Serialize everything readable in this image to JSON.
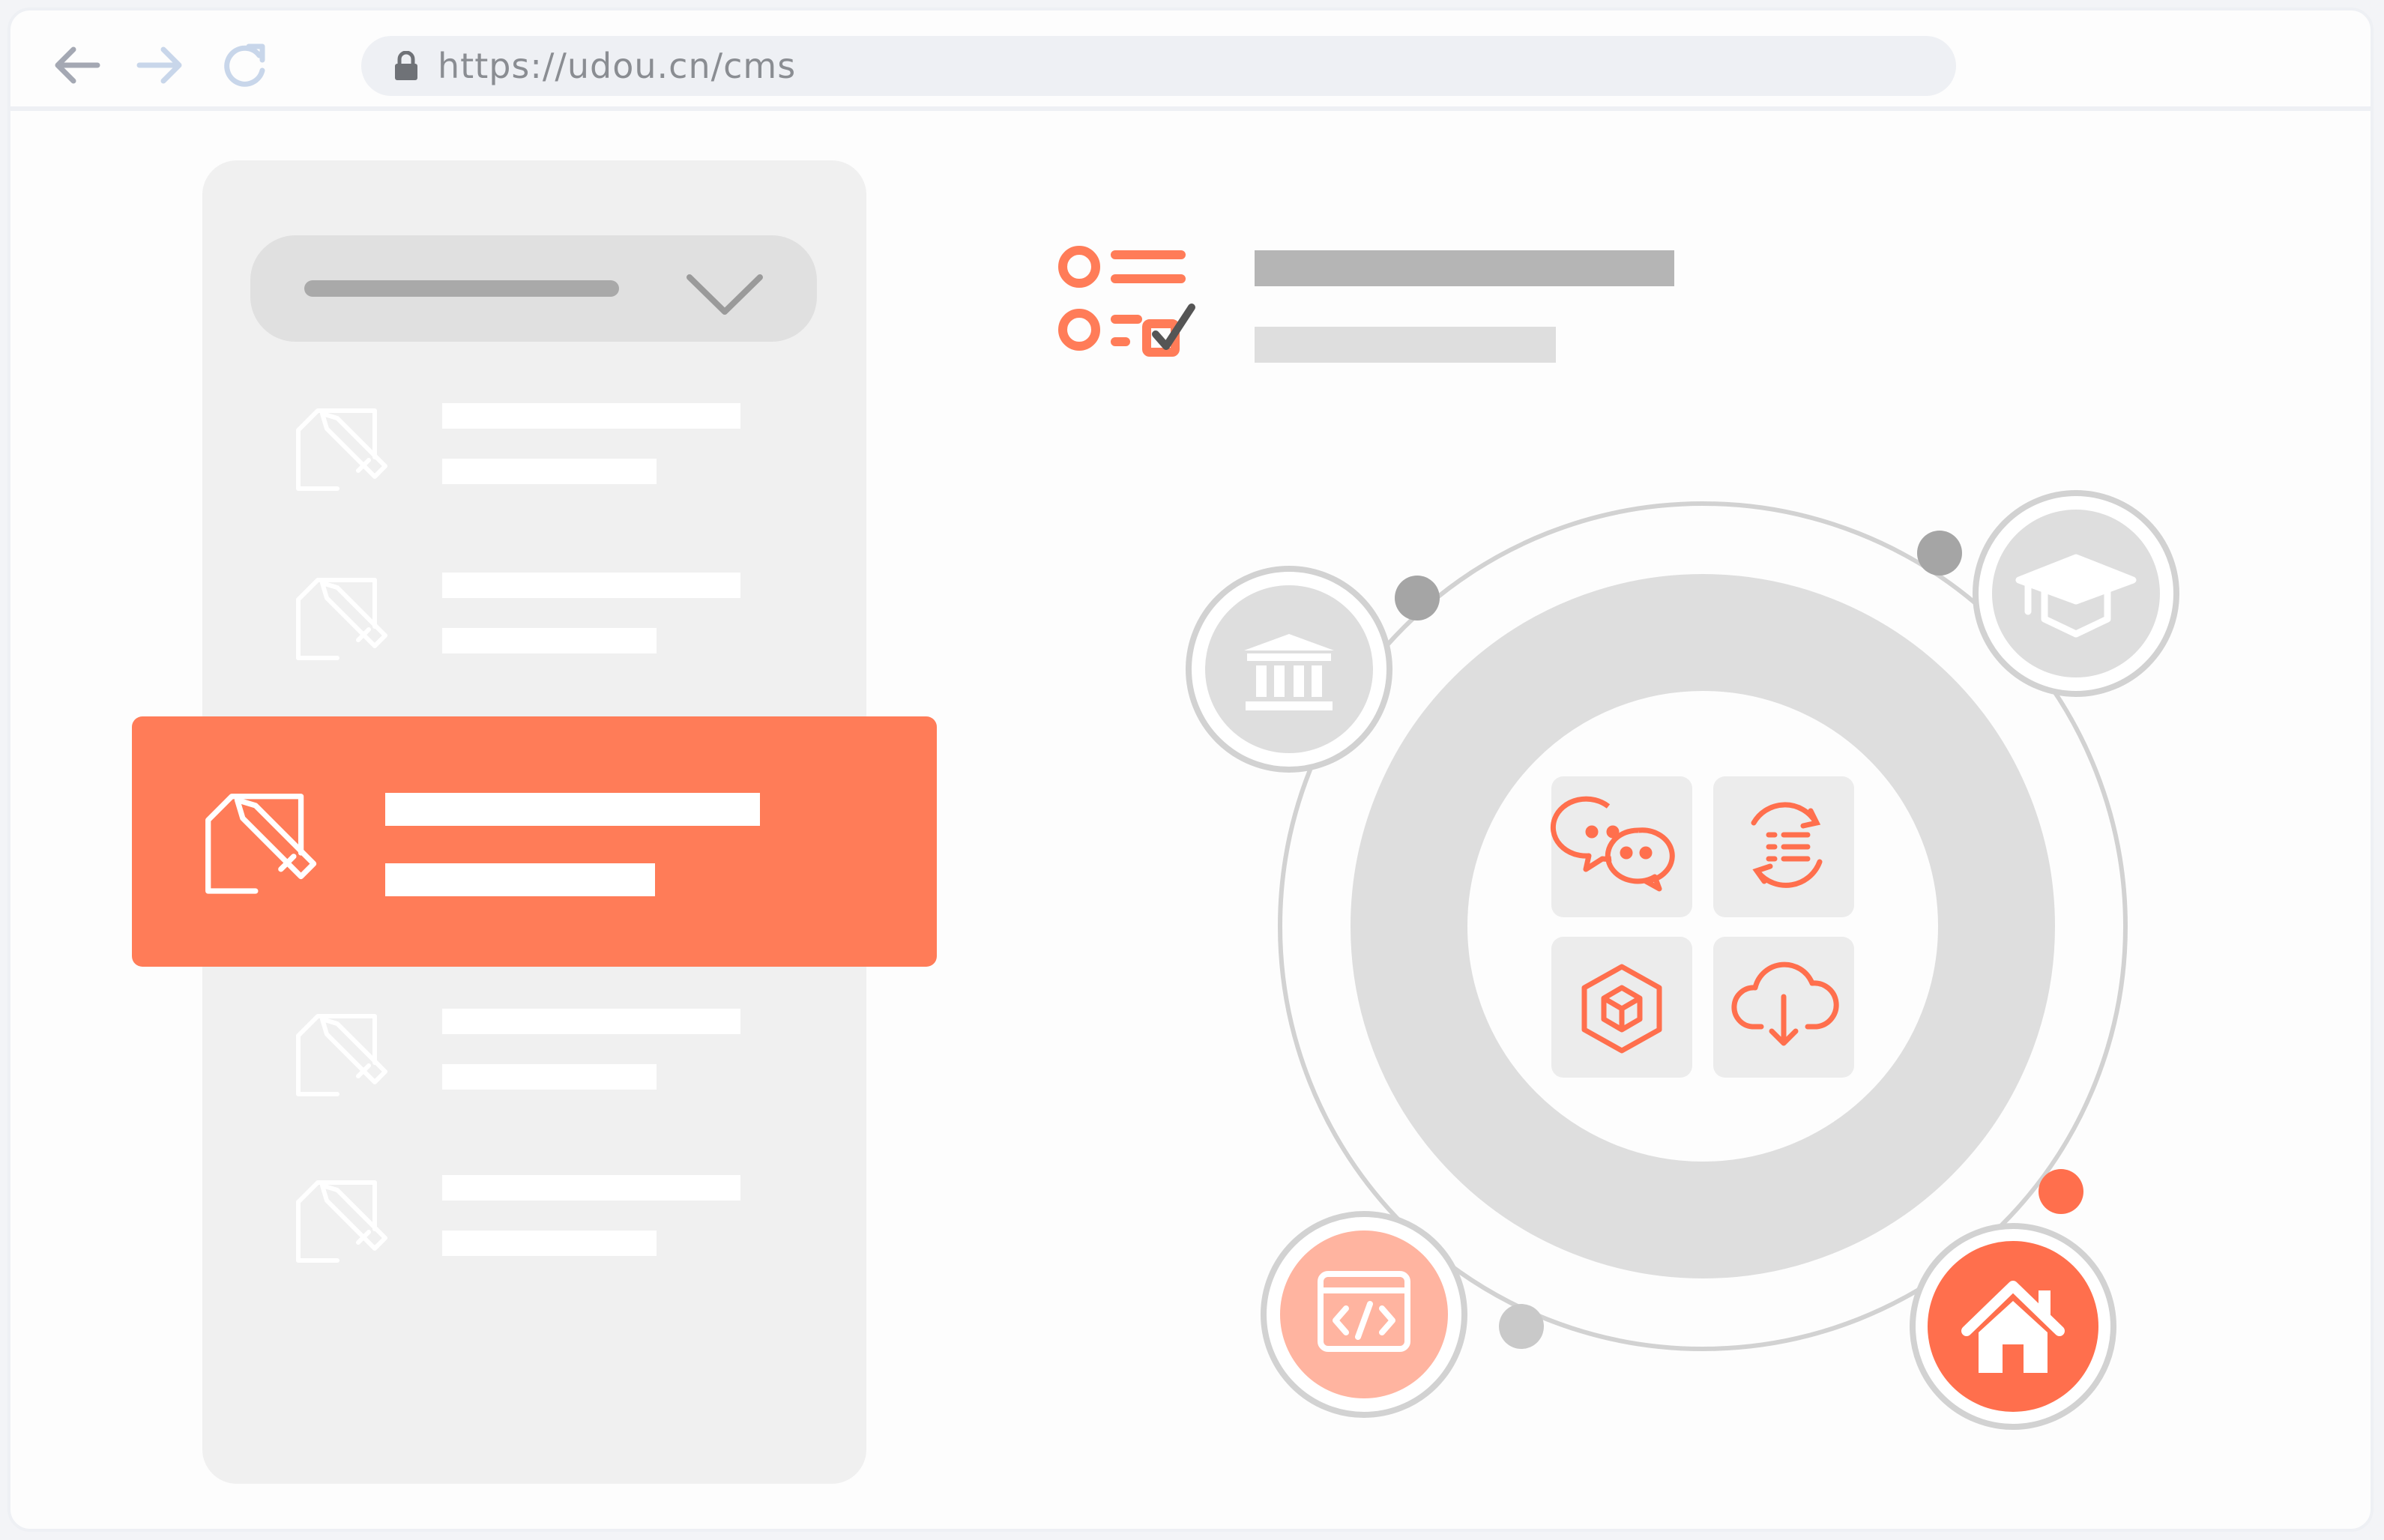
{
  "browser": {
    "url": "https://udou.cn/cms",
    "nav": {
      "back_icon": "arrow-left-icon",
      "forward_icon": "arrow-right-icon",
      "reload_icon": "reload-icon",
      "lock_icon": "lock-icon"
    }
  },
  "sidebar": {
    "dropdown_icon": "chevron-down-icon",
    "items": [
      {
        "icon": "edit-document-icon",
        "active": false
      },
      {
        "icon": "edit-document-icon",
        "active": false
      },
      {
        "icon": "edit-document-icon",
        "active": true
      },
      {
        "icon": "edit-document-icon",
        "active": false
      },
      {
        "icon": "edit-document-icon",
        "active": false
      }
    ]
  },
  "header": {
    "icon": "checklist-icon"
  },
  "hub": {
    "center_icons": [
      "wechat-icon",
      "list-sync-icon",
      "cube-icon",
      "cloud-download-icon"
    ],
    "satellites": [
      "bank-icon",
      "graduation-cap-icon",
      "code-window-icon",
      "home-icon"
    ]
  },
  "colors": {
    "accent": "#ff7c58",
    "accent_light": "#ffb4a0",
    "panel": "#f0f0f0",
    "ring": "#dedede",
    "placeholder_dark": "#b5b5b5"
  }
}
